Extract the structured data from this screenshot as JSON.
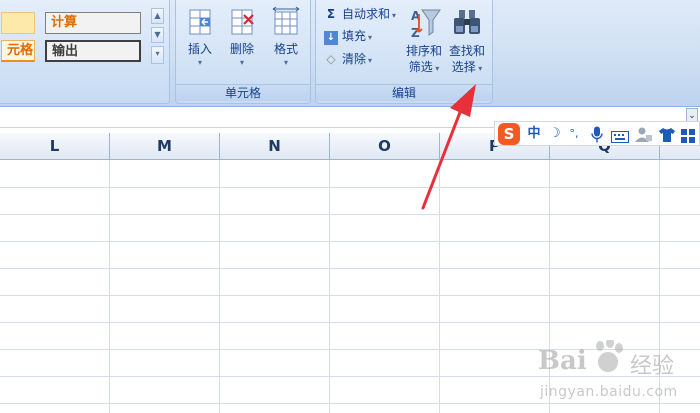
{
  "ribbon": {
    "styles": {
      "cell_partial": "元格",
      "calc": "计算",
      "output": "输出"
    },
    "cells_group": {
      "label": "单元格",
      "insert": "插入",
      "delete": "删除",
      "format": "格式"
    },
    "editing_group": {
      "label": "编辑",
      "autosum": "自动求和",
      "fill": "填充",
      "clear": "清除",
      "sort_filter_1": "排序和",
      "sort_filter_2": "筛选",
      "find_select_1": "查找和",
      "find_select_2": "选择"
    }
  },
  "ime": {
    "logo": "S",
    "mode": "中",
    "moon": "☽",
    "punct": "°,",
    "mic": "🎤"
  },
  "grid": {
    "columns": [
      "L",
      "M",
      "N",
      "O",
      "P",
      "Q"
    ]
  },
  "watermark": {
    "brand": "Bai",
    "brand2": "经验",
    "url": "jingyan.baidu.com"
  },
  "colors": {
    "ribbon_text": "#15428b",
    "calc_text": "#e06c00",
    "arrow": "#e8303a"
  }
}
